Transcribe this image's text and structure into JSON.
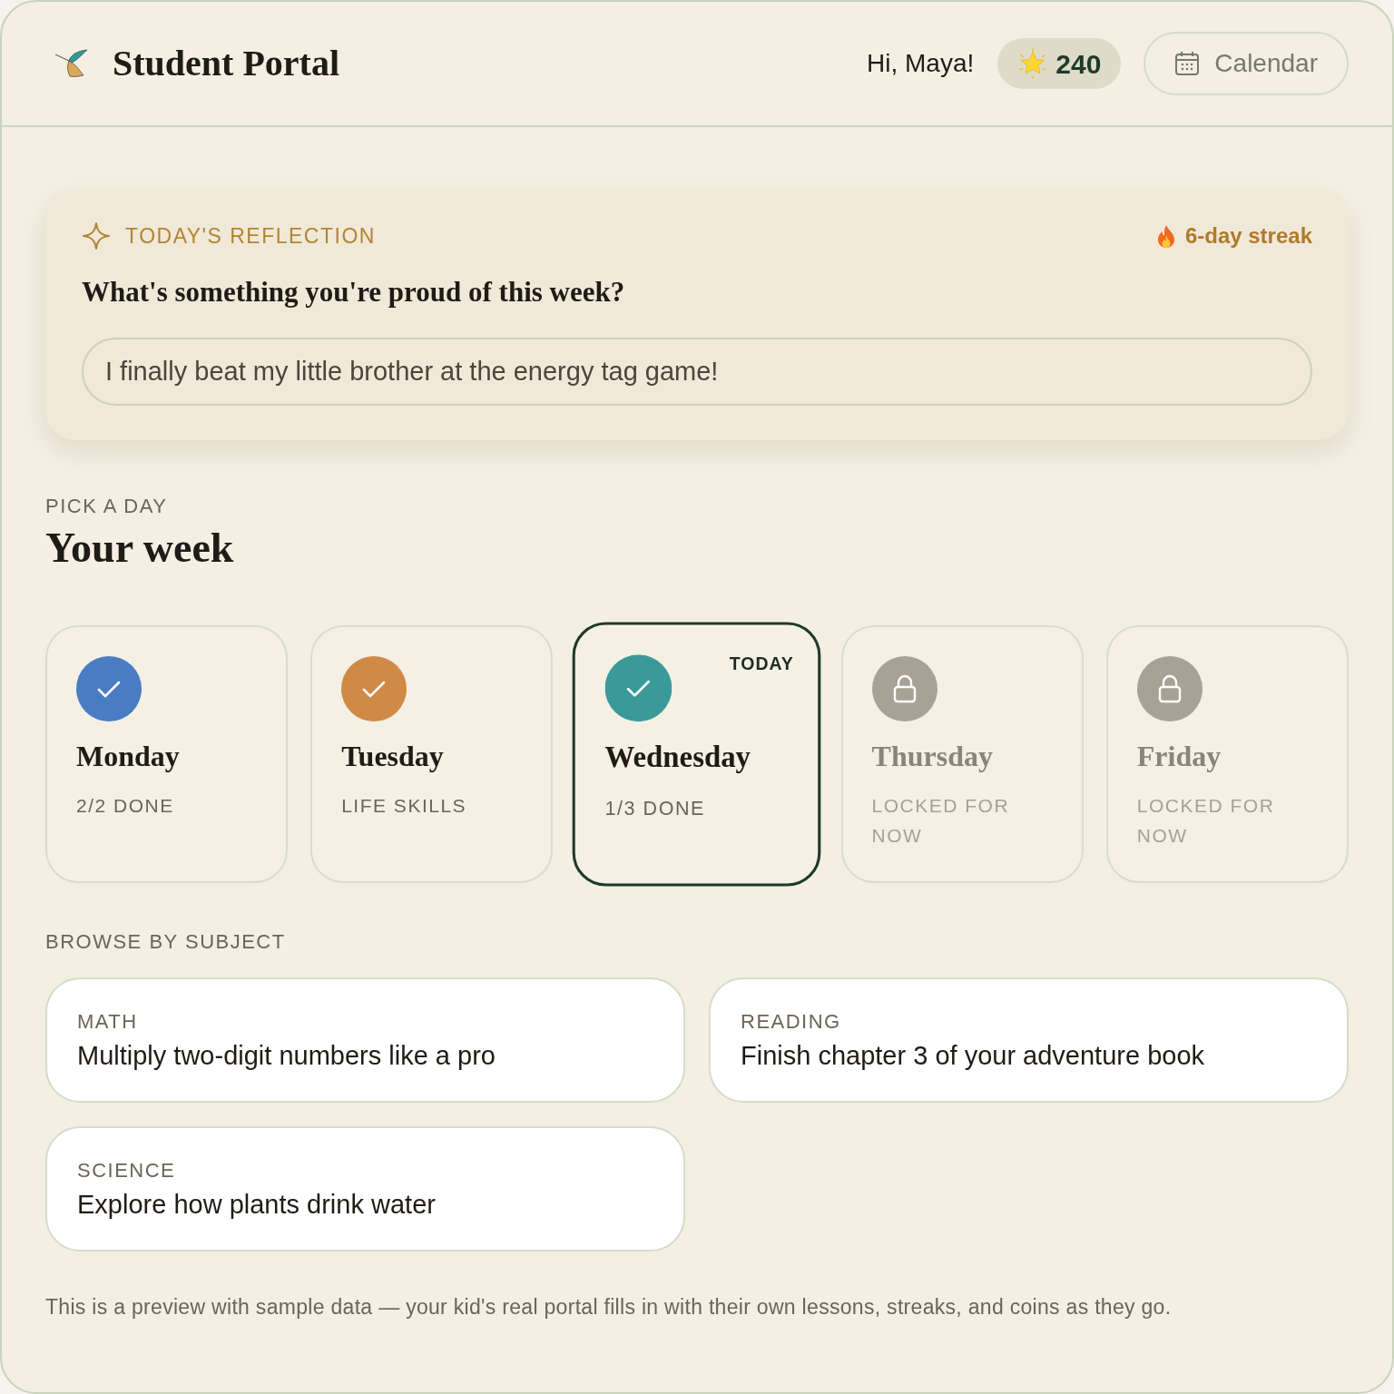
{
  "header": {
    "title": "Student Portal",
    "greeting": "Hi, Maya!",
    "coins": "240",
    "calendar_button": "Calendar"
  },
  "reflection": {
    "label": "TODAY'S REFLECTION",
    "streak": "6-day streak",
    "question": "What's something you're proud of this week?",
    "answer": "I finally beat my little brother at the energy tag game!"
  },
  "week": {
    "eyebrow": "PICK A DAY",
    "title": "Your week",
    "days": [
      {
        "name": "Monday",
        "status": "2/2 DONE",
        "locked": false,
        "color": "#4a7cc4",
        "selected": false
      },
      {
        "name": "Tuesday",
        "status": "LIFE SKILLS",
        "locked": false,
        "color": "#d08a45",
        "selected": false
      },
      {
        "name": "Wednesday",
        "status": "1/3 DONE",
        "locked": false,
        "color": "#3a9a98",
        "selected": true,
        "badge": "TODAY"
      },
      {
        "name": "Thursday",
        "status": "LOCKED FOR NOW",
        "locked": true,
        "color": "#a8a195",
        "selected": false
      },
      {
        "name": "Friday",
        "status": "LOCKED FOR NOW",
        "locked": true,
        "color": "#a8a195",
        "selected": false
      }
    ]
  },
  "subjects": {
    "label": "BROWSE BY SUBJECT",
    "items": [
      {
        "subject": "MATH",
        "title": "Multiply two-digit numbers like a pro"
      },
      {
        "subject": "READING",
        "title": "Finish chapter 3 of your adventure book"
      },
      {
        "subject": "SCIENCE",
        "title": "Explore how plants drink water"
      }
    ]
  },
  "footer": "This is a preview with sample data — your kid's real portal fills in with their own lessons, streaks, and coins as they go."
}
